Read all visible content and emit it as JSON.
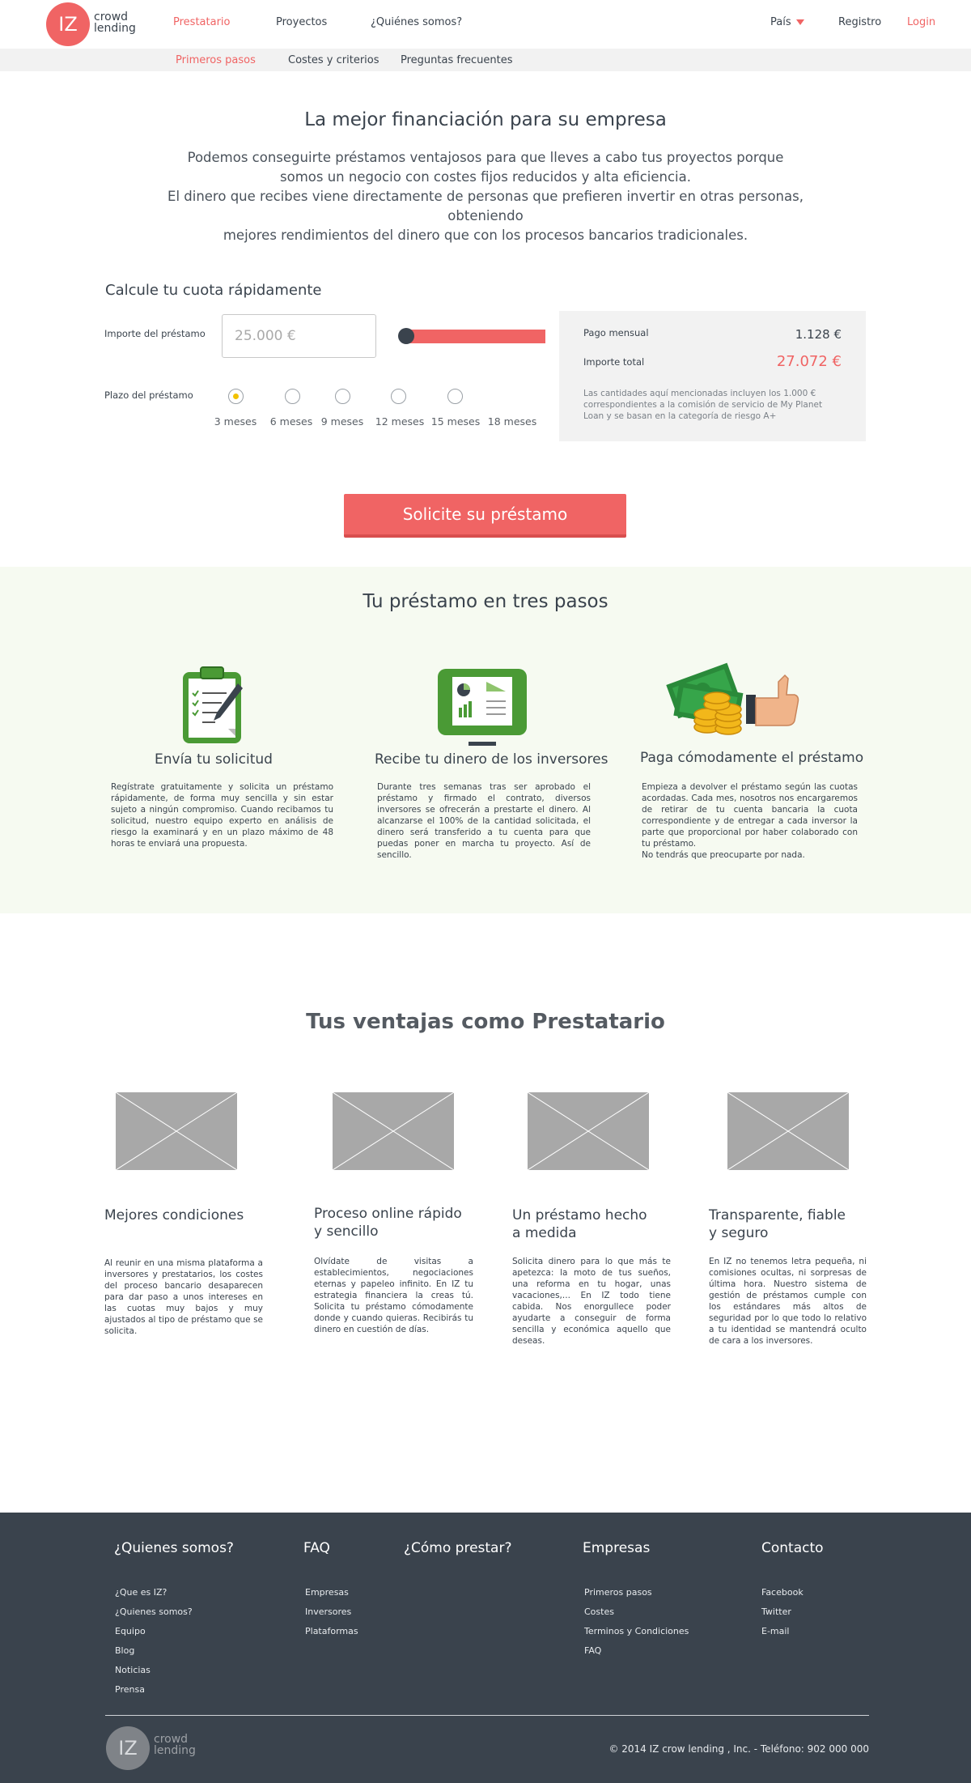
{
  "header": {
    "logo_mark": "IZ",
    "logo_word_1": "crowd",
    "logo_word_2": "lending",
    "nav": [
      "Prestatario",
      "Proyectos",
      "¿Quiénes somos?"
    ],
    "country": "País",
    "register": "Registro",
    "login": "Login"
  },
  "subnav": [
    "Primeros pasos",
    "Costes y criterios",
    "Preguntas frecuentes"
  ],
  "hero": {
    "title": "La mejor financiación para su empresa",
    "lines": [
      "Podemos conseguirte préstamos ventajosos para que lleves a cabo tus proyectos porque",
      "somos un negocio con costes fijos reducidos y alta eficiencia.",
      "El dinero que recibes viene directamente de personas que prefieren invertir en otras personas, obteniendo",
      "mejores rendimientos del dinero que con los procesos bancarios tradicionales."
    ]
  },
  "calculator": {
    "title": "Calcule tu cuota rápidamente",
    "amount_label": "Importe del préstamo",
    "amount_placeholder": "25.000 €",
    "slider_position": 0.0,
    "term_label": "Plazo del préstamo",
    "terms": [
      "3 meses",
      "6 meses",
      "9 meses",
      "12 meses",
      "15 meses",
      "18 meses"
    ],
    "selected_term": "3 meses",
    "monthly_label": "Pago mensual",
    "monthly_value": "1.128  €",
    "total_label": "Importe total",
    "total_value": "27.072 €",
    "note": "Las cantidades aquí mencionadas incluyen los 1.000 € correspondientes a la comisión de servicio de My Planet Loan y se basan en la categoría de riesgo A+"
  },
  "cta": "Solicite su préstamo",
  "steps": {
    "title": "Tu préstamo en tres pasos",
    "items": [
      {
        "icon": "clipboard-icon",
        "title": "Envía tu solicitud",
        "desc": "Regístrate gratuitamente y solicita un préstamo rápidamente, de forma muy sencilla y sin estar sujeto a ningún compromiso. Cuando recibamos tu solicitud, nuestro equipo experto en análisis de riesgo la examinará y en un plazo máximo de 48 horas te enviará una propuesta."
      },
      {
        "icon": "monitor-chart-icon",
        "title": "Recibe tu dinero de los inversores",
        "desc": "Durante tres semanas tras ser aprobado el préstamo y firmado el contrato, diversos inversores se ofrecerán a prestarte el dinero. Al alcanzarse el 100% de la cantidad solicitada, el dinero será transferido a tu cuenta para que puedas poner en marcha tu proyecto. Así de sencillo."
      },
      {
        "icon": "money-thumbs-up-icon",
        "title": "Paga cómodamente el préstamo",
        "desc": "Empieza a devolver el préstamo según las cuotas acordadas. Cada mes, nosotros nos encargaremos de retirar de tu cuenta bancaria la cuota correspondiente y de entregar a cada inversor la parte que proporcional por haber colaborado con tu préstamo.\nNo tendrás que preocuparte por nada."
      }
    ]
  },
  "advantages": {
    "title": "Tus ventajas como Prestatario",
    "items": [
      {
        "title": "Mejores condiciones",
        "desc": "Al reunir en una misma plataforma a inversores y prestatarios, los costes del proceso bancario desaparecen para dar paso a unos intereses en las cuotas muy bajos y muy ajustados al tipo de préstamo que se solicita."
      },
      {
        "title": "Proceso online rápido\ny sencillo",
        "desc": "Olvídate de visitas a establecimientos, negociaciones eternas y papeleo infinito. En IZ tu estrategia financiera la creas tú. Solicita tu préstamo cómodamente donde y cuando quieras. Recibirás tu dinero en cuestión de días."
      },
      {
        "title": "Un préstamo hecho\na medida",
        "desc": "Solicita dinero para lo que más te apetezca: la moto de tus sueños, una reforma en tu hogar, unas vacaciones,... En IZ todo tiene cabida. Nos enorgullece poder ayudarte a conseguir de forma sencilla y económica aquello que deseas."
      },
      {
        "title": "Transparente, fiable\ny seguro",
        "desc": "En IZ no tenemos letra pequeña, ni comisiones ocultas, ni sorpresas de última hora. Nuestro sistema de gestión de préstamos cumple con los estándares más altos de seguridad por lo que todo lo relativo a tu identidad se mantendrá oculto de cara a los inversores."
      }
    ]
  },
  "footer": {
    "columns": [
      {
        "heading": "¿Quienes somos?",
        "links": [
          "¿Que es IZ?",
          "¿Quienes somos?",
          "Equipo",
          "Blog",
          "Noticias",
          "Prensa"
        ]
      },
      {
        "heading": "FAQ",
        "links": [
          "Empresas",
          "Inversores",
          "Plataformas"
        ]
      },
      {
        "heading": "¿Cómo prestar?",
        "links": []
      },
      {
        "heading": "Empresas",
        "links": [
          "Primeros pasos",
          "Costes",
          "Terminos y Condiciones",
          "FAQ"
        ]
      },
      {
        "heading": "Contacto",
        "links": [
          "Facebook",
          "Twitter",
          "E-mail"
        ]
      }
    ],
    "logo_mark": "IZ",
    "logo_word_1": "crowd",
    "logo_word_2": "lending",
    "copyright": "© 2014 IZ crow lending , Inc. - Teléfono: 902 000 000"
  },
  "colors": {
    "accent": "#f06464",
    "dark": "#3a434d",
    "green": "#4a9a35",
    "steps_bg": "#f6faf1"
  }
}
